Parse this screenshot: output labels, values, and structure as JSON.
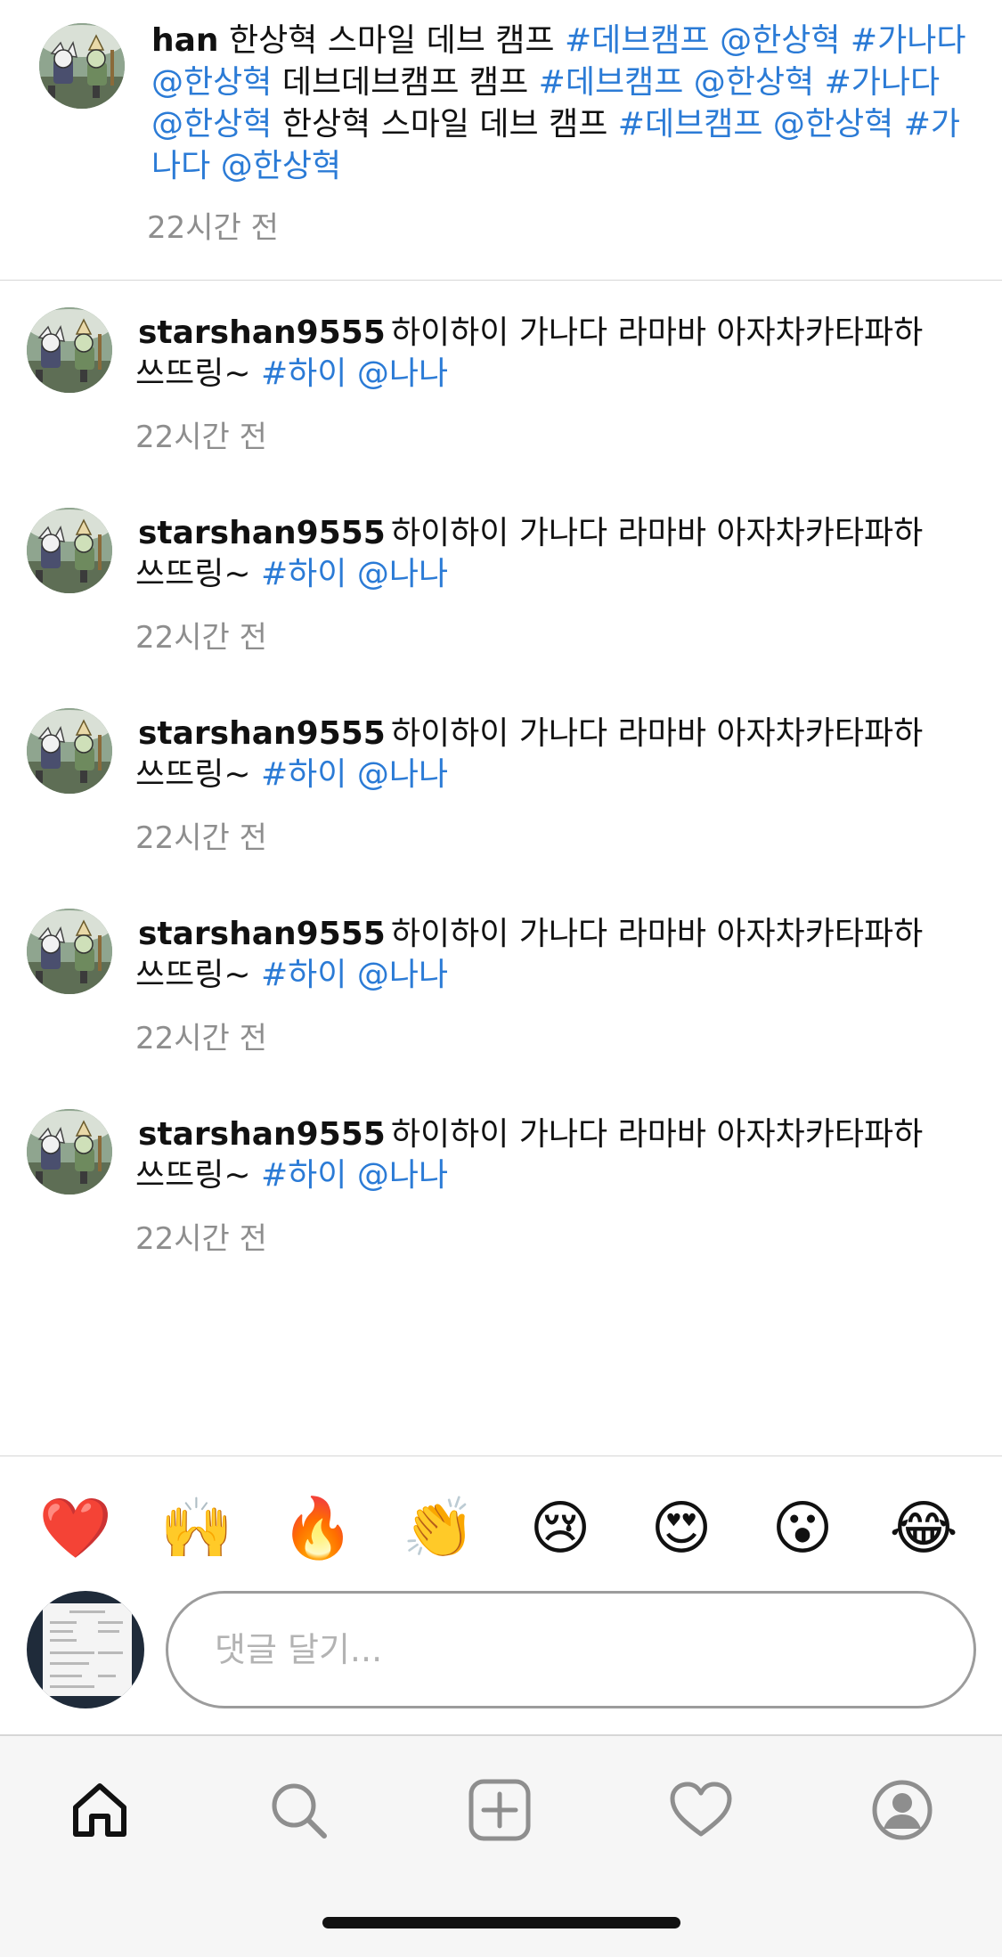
{
  "caption": {
    "avatar_icon": "profile-photo",
    "segments": [
      {
        "text": "han",
        "type": "username"
      },
      {
        "text": " 한상혁 스마일 데브 캠프 ",
        "type": "text"
      },
      {
        "text": "#데브캠프",
        "type": "link"
      },
      {
        "text": " ",
        "type": "text"
      },
      {
        "text": "@한상혁",
        "type": "link"
      },
      {
        "text": " ",
        "type": "text"
      },
      {
        "text": "#가나다",
        "type": "link"
      },
      {
        "text": " ",
        "type": "text"
      },
      {
        "text": "@한상혁",
        "type": "link"
      },
      {
        "text": " 데브데브캠프 캠프 ",
        "type": "text"
      },
      {
        "text": "#데브캠프",
        "type": "link"
      },
      {
        "text": " ",
        "type": "text"
      },
      {
        "text": "@한상혁",
        "type": "link"
      },
      {
        "text": " ",
        "type": "text"
      },
      {
        "text": "#가나다",
        "type": "link"
      },
      {
        "text": " ",
        "type": "text"
      },
      {
        "text": "@한상혁",
        "type": "link"
      },
      {
        "text": " 한상혁 스마일 데브 캠프 ",
        "type": "text"
      },
      {
        "text": "#데브캠프",
        "type": "link"
      },
      {
        "text": " ",
        "type": "text"
      },
      {
        "text": "@한상혁",
        "type": "link"
      },
      {
        "text": " ",
        "type": "text"
      },
      {
        "text": "#가나다",
        "type": "link"
      },
      {
        "text": " ",
        "type": "text"
      },
      {
        "text": "@한상혁",
        "type": "link"
      }
    ],
    "time": "22시간 전"
  },
  "comments": [
    {
      "username": "starshan9555",
      "text": "하이하이 가나다 라마바 아자차카타파하 쓰뜨링~",
      "hashtag": "#하이",
      "mention": "@나나",
      "time": "22시간 전"
    },
    {
      "username": "starshan9555",
      "text": "하이하이 가나다 라마바 아자차카타파하 쓰뜨링~",
      "hashtag": "#하이",
      "mention": "@나나",
      "time": "22시간 전"
    },
    {
      "username": "starshan9555",
      "text": "하이하이 가나다 라마바 아자차카타파하 쓰뜨링~",
      "hashtag": "#하이",
      "mention": "@나나",
      "time": "22시간 전"
    },
    {
      "username": "starshan9555",
      "text": "하이하이 가나다 라마바 아자차카타파하 쓰뜨링~",
      "hashtag": "#하이",
      "mention": "@나나",
      "time": "22시간 전"
    },
    {
      "username": "starshan9555",
      "text": "하이하이 가나다 라마바 아자차카타파하 쓰뜨링~",
      "hashtag": "#하이",
      "mention": "@나나",
      "time": "22시간 전"
    }
  ],
  "emoji_bar": [
    {
      "emoji": "❤️",
      "name": "red-heart"
    },
    {
      "emoji": "🙌",
      "name": "raising-hands"
    },
    {
      "emoji": "🔥",
      "name": "fire"
    },
    {
      "emoji": "👏",
      "name": "clapping-hands"
    },
    {
      "emoji": "😢",
      "name": "crying-face"
    },
    {
      "emoji": "😍",
      "name": "heart-eyes"
    },
    {
      "emoji": "😮",
      "name": "surprised-face"
    },
    {
      "emoji": "😂",
      "name": "tears-of-joy"
    }
  ],
  "comment_input": {
    "placeholder": "댓글 달기...",
    "value": ""
  },
  "tab_bar": [
    {
      "icon": "home-icon",
      "active": true
    },
    {
      "icon": "search-icon",
      "active": false
    },
    {
      "icon": "add-post-icon",
      "active": false
    },
    {
      "icon": "heart-icon",
      "active": false
    },
    {
      "icon": "profile-icon",
      "active": false
    }
  ],
  "colors": {
    "link": "#2b7bd6",
    "timestamp": "#8e8e8e",
    "placeholder": "#b3b3b3",
    "tab_active": "#111111",
    "tab_inactive": "#8e8e8e",
    "tabbar_background": "#f6f6f6"
  }
}
